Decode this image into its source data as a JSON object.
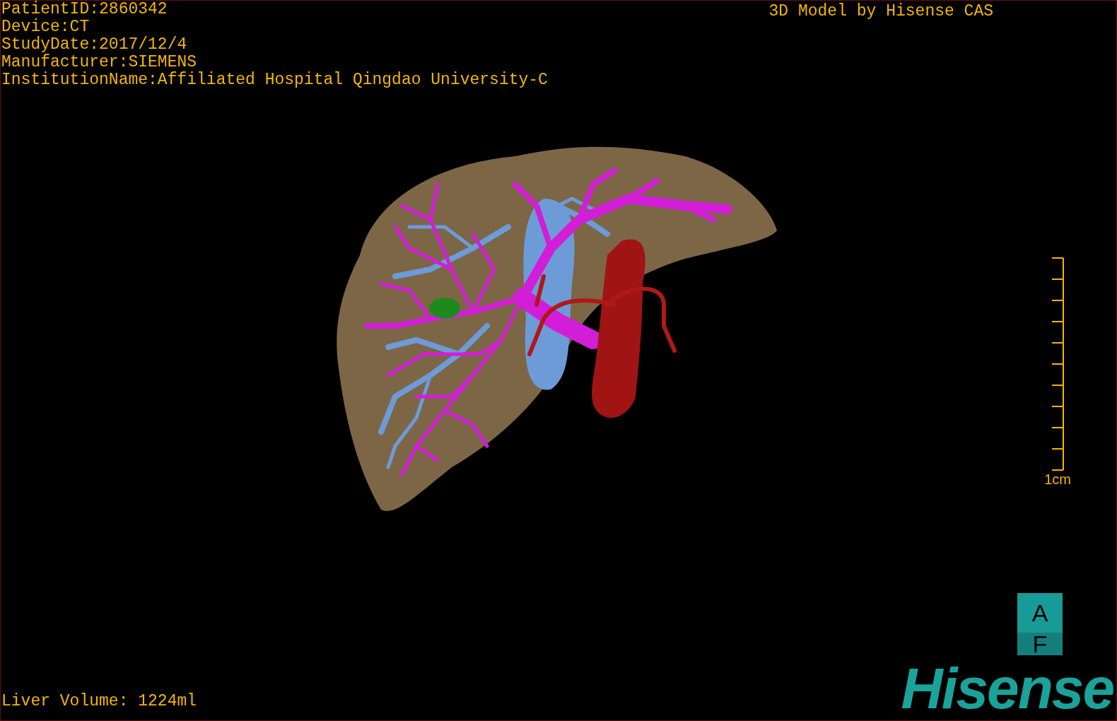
{
  "info": [
    "PatientID:2860342",
    "Device:CT",
    "StudyDate:2017/12/4",
    "Manufacturer:SIEMENS",
    "InstitutionName:Affiliated Hospital Qingdao University-C"
  ],
  "title": "3D Model by Hisense CAS",
  "scale_label": "1cm",
  "volume": "Liver Volume: 1224ml",
  "orientation": {
    "top": "A",
    "bottom": "F"
  },
  "logo": "Hisense"
}
